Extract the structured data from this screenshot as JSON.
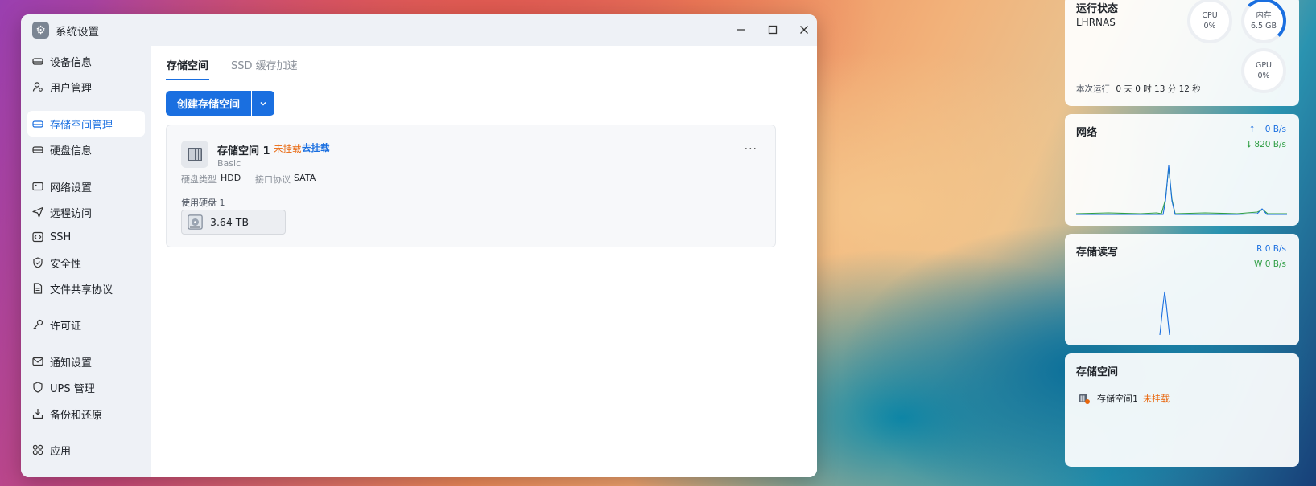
{
  "window": {
    "title": "系统设置",
    "minimize": "—",
    "maximize": "☐",
    "close": "✕"
  },
  "sidebar": {
    "items": [
      {
        "label": "设备信息",
        "icon": "device-icon"
      },
      {
        "label": "用户管理",
        "icon": "user-icon"
      },
      {
        "label": "存储空间管理",
        "icon": "storage-icon",
        "active": true
      },
      {
        "label": "硬盘信息",
        "icon": "disk-icon"
      },
      {
        "label": "网络设置",
        "icon": "network-icon"
      },
      {
        "label": "远程访问",
        "icon": "send-icon"
      },
      {
        "label": "SSH",
        "icon": "code-icon"
      },
      {
        "label": "安全性",
        "icon": "shield-icon"
      },
      {
        "label": "文件共享协议",
        "icon": "file-icon"
      },
      {
        "label": "许可证",
        "icon": "key-icon"
      },
      {
        "label": "通知设置",
        "icon": "mail-icon"
      },
      {
        "label": "UPS 管理",
        "icon": "ups-shield-icon"
      },
      {
        "label": "备份和还原",
        "icon": "backup-icon"
      },
      {
        "label": "应用",
        "icon": "apps-icon"
      }
    ]
  },
  "tabs": [
    {
      "label": "存储空间",
      "active": true
    },
    {
      "label": "SSD 缓存加速",
      "active": false
    }
  ],
  "actions": {
    "create_label": "创建存储空间"
  },
  "pool": {
    "name": "存储空间 1",
    "status": "未挂载",
    "mount_action": "去挂载",
    "raid_level": "Basic",
    "disk_type_label": "硬盘类型",
    "disk_type_value": "HDD",
    "interface_label": "接口协议",
    "interface_value": "SATA",
    "disks_label": "使用硬盘 1",
    "disk_size": "3.64 TB",
    "more": "···"
  },
  "status_widget": {
    "title": "运行状态",
    "hostname": "LHRNAS",
    "cpu_label": "CPU",
    "cpu_value": "0%",
    "mem_label": "内存",
    "mem_value": "6.5 GB",
    "gpu_label": "GPU",
    "gpu_value": "0%",
    "uptime_prefix": "本次运行",
    "uptime": "0 天 0 时 13 分 12 秒"
  },
  "network_widget": {
    "title": "网络",
    "upload": "0 B/s",
    "download": "820 B/s"
  },
  "io_widget": {
    "title": "存储读写",
    "read": "R  0 B/s",
    "write": "W  0 B/s"
  },
  "storage_widget": {
    "title": "存储空间",
    "pool_name": "存储空间1",
    "pool_status": "未挂载"
  },
  "colors": {
    "accent": "#1a6fe0",
    "warning": "#e8660c",
    "download": "#2f9e44"
  }
}
